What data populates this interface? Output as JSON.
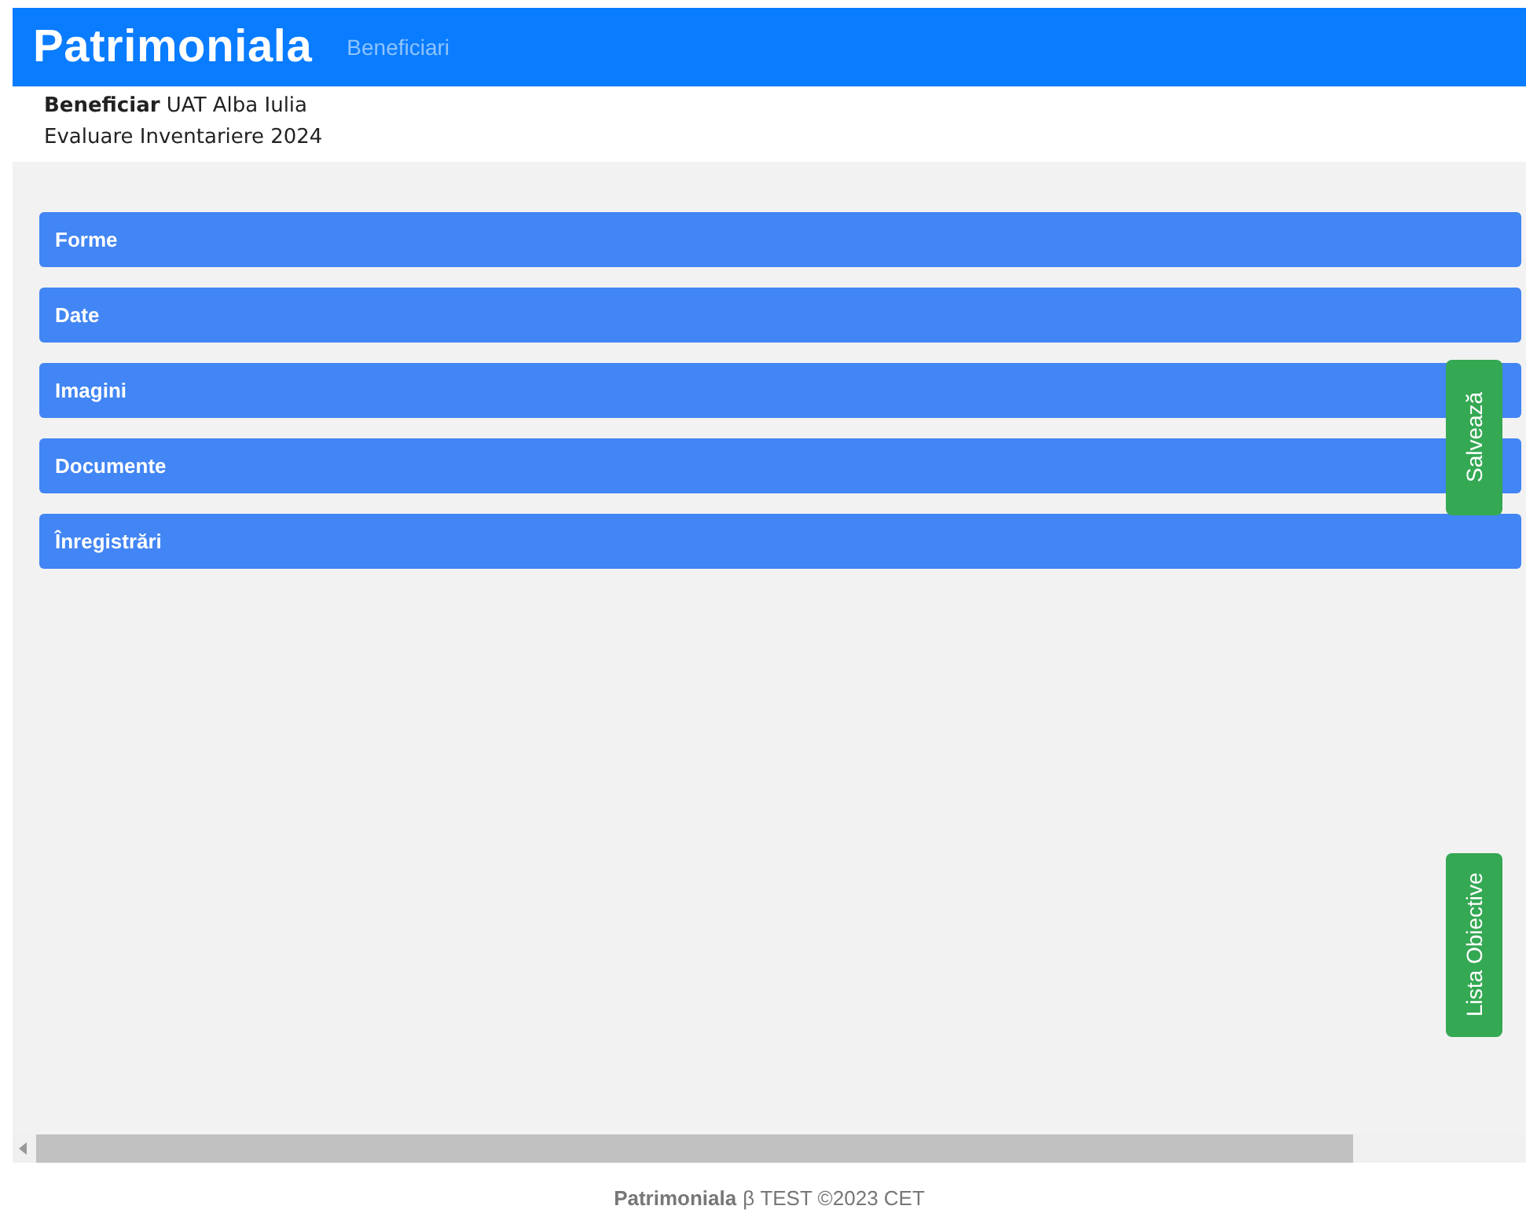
{
  "navbar": {
    "brand": "Patrimoniala",
    "links": [
      "Beneficiari"
    ]
  },
  "header": {
    "beneficiary_label": "Beneficiar",
    "beneficiary": "UAT Alba Iulia",
    "subtitle": "Evaluare Inventariere 2024"
  },
  "sections": [
    "Forme",
    "Date",
    "Imagini",
    "Documente",
    "Înregistrări"
  ],
  "side_buttons": [
    "Salvează",
    "Lista Obiective"
  ],
  "footer": {
    "brand": "Patrimoniala",
    "text": "β TEST ©2023 CET"
  }
}
